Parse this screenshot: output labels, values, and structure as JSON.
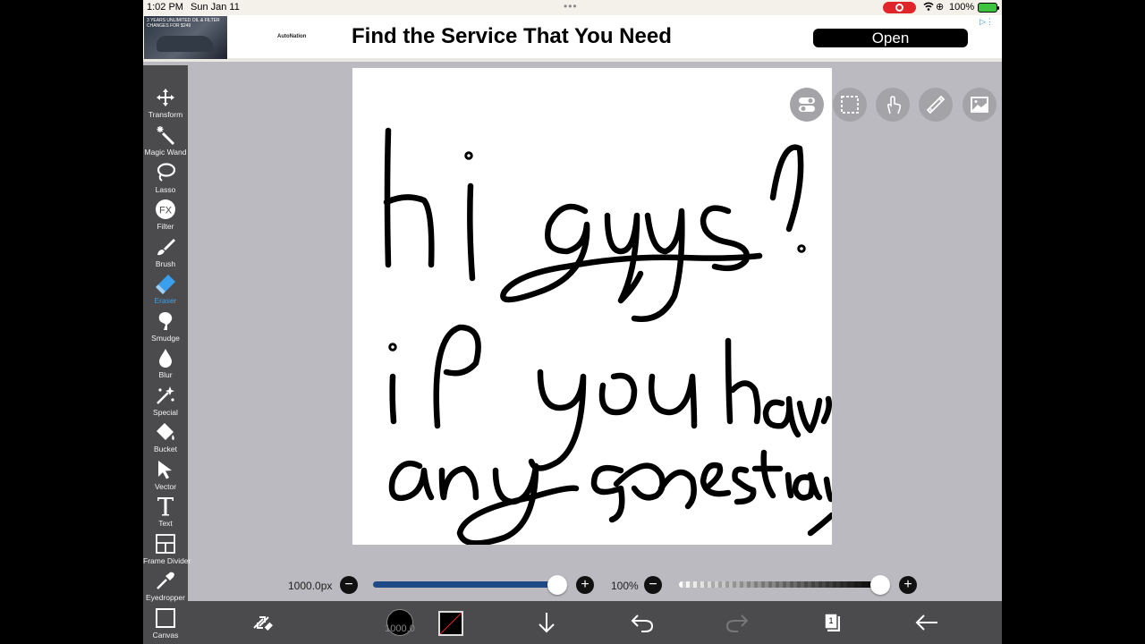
{
  "status_bar": {
    "time": "1:02 PM",
    "date": "Sun Jan 11",
    "battery": "100%"
  },
  "ad": {
    "thumb_text": "3 YEARS UNLIMITED OIL & FILTER CHANGES FOR $249",
    "brand": "AutoNation",
    "headline": "Find the Service That You Need",
    "cta": "Open"
  },
  "tools": [
    {
      "id": "transform",
      "label": "Transform",
      "icon": "move-arrows-icon"
    },
    {
      "id": "magic-wand",
      "label": "Magic Wand",
      "icon": "magic-wand-icon"
    },
    {
      "id": "lasso",
      "label": "Lasso",
      "icon": "lasso-icon"
    },
    {
      "id": "filter",
      "label": "Filter",
      "icon": "fx-icon"
    },
    {
      "id": "brush",
      "label": "Brush",
      "icon": "brush-icon"
    },
    {
      "id": "eraser",
      "label": "Eraser",
      "icon": "eraser-icon",
      "active": true
    },
    {
      "id": "smudge",
      "label": "Smudge",
      "icon": "smudge-icon"
    },
    {
      "id": "blur",
      "label": "Blur",
      "icon": "droplet-icon"
    },
    {
      "id": "special",
      "label": "Special",
      "icon": "sparkle-icon"
    },
    {
      "id": "bucket",
      "label": "Bucket",
      "icon": "bucket-icon"
    },
    {
      "id": "vector",
      "label": "Vector",
      "icon": "cursor-arrow-icon"
    },
    {
      "id": "text",
      "label": "Text",
      "icon": "text-t-icon"
    },
    {
      "id": "frame-divider",
      "label": "Frame Divider",
      "icon": "frame-divider-icon"
    },
    {
      "id": "eyedropper",
      "label": "Eyedropper",
      "icon": "eyedropper-icon"
    },
    {
      "id": "canvas",
      "label": "Canvas",
      "icon": "canvas-square-icon"
    }
  ],
  "quick_buttons": [
    "toggle-icon",
    "selection-marquee-icon",
    "touch-hand-icon",
    "ruler-icon",
    "material-image-icon"
  ],
  "brush_size": {
    "value_label": "1000.0px",
    "fraction": 1.0
  },
  "opacity": {
    "value_label": "100%",
    "fraction": 1.0
  },
  "bottom_bar": {
    "brush_size_label": "1000.0",
    "layer_count": "1",
    "accent_color": "#3aa0ee"
  }
}
